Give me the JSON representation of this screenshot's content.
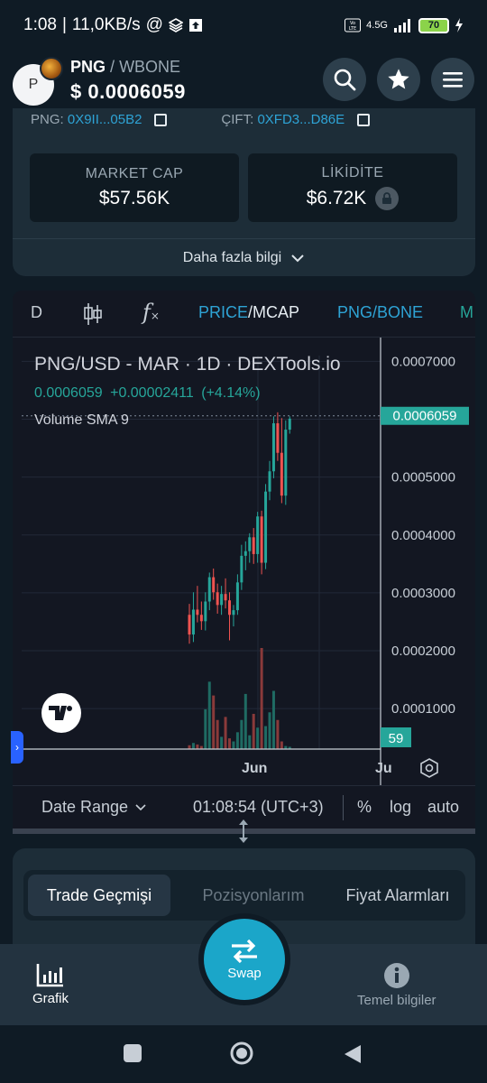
{
  "status_bar": {
    "time": "1:08",
    "speed": "11,0KB/s",
    "network": "4.5G",
    "battery": "70"
  },
  "header": {
    "avatar_letter": "P",
    "base": "PNG",
    "separator": "/",
    "quote": "WBONE",
    "price": "$ 0.0006059"
  },
  "info": {
    "token_label": "PNG:",
    "token_addr": "0X9II...05B2",
    "pair_label": "ÇIFT:",
    "pair_addr": "0XFD3...D86E",
    "market_cap_label": "MARKET CAP",
    "market_cap_value": "$57.56K",
    "liquidity_label": "LİKİDİTE",
    "liquidity_value": "$6.72K",
    "more_label": "Daha fazla bilgi"
  },
  "chart_toolbar": {
    "interval": "D",
    "fx": "f",
    "price_label": "PRICE",
    "slash": "/",
    "mcap_label": "MCAP",
    "pair_label": "PNG/BONE",
    "cut_label": "M"
  },
  "chart_data": {
    "type": "candlestick",
    "title": "PNG/USD - MAR · 1D · DEXTools.io",
    "last_price": "0.0006059",
    "change": "+0.00002411",
    "change_pct": "(+4.14%)",
    "indicator": "Volume SMA 9",
    "ylim": [
      3e-05,
      0.00071
    ],
    "y_ticks": [
      0.0007,
      0.0006,
      0.0005,
      0.0004,
      0.0003,
      0.0002,
      0.0001
    ],
    "y_tick_labels": [
      "0.0007000",
      "0.0006000",
      "0.0005000",
      "0.0004000",
      "0.0003000",
      "0.0002000",
      "0.0001000"
    ],
    "price_tag": "0.0006059",
    "volume_tag": "59",
    "x_labels": [
      "Jun",
      "Ju"
    ],
    "up_color": "#26a69a",
    "down_color": "#ef5350",
    "candles": [
      {
        "o": 0.000262,
        "h": 0.000281,
        "l": 0.000212,
        "c": 0.000228
      },
      {
        "o": 0.000228,
        "h": 0.000301,
        "l": 0.000215,
        "c": 0.000271
      },
      {
        "o": 0.000271,
        "h": 0.000312,
        "l": 0.000249,
        "c": 0.000262
      },
      {
        "o": 0.000262,
        "h": 0.000285,
        "l": 0.000236,
        "c": 0.000251
      },
      {
        "o": 0.000251,
        "h": 0.000301,
        "l": 0.000235,
        "c": 0.000285
      },
      {
        "o": 0.000285,
        "h": 0.000335,
        "l": 0.00027,
        "c": 0.000327
      },
      {
        "o": 0.000327,
        "h": 0.000342,
        "l": 0.000288,
        "c": 0.000301
      },
      {
        "o": 0.000301,
        "h": 0.000316,
        "l": 0.000264,
        "c": 0.000279
      },
      {
        "o": 0.000279,
        "h": 0.000312,
        "l": 0.000262,
        "c": 0.000298
      },
      {
        "o": 0.000298,
        "h": 0.000325,
        "l": 0.000273,
        "c": 0.000287
      },
      {
        "o": 0.000287,
        "h": 0.000301,
        "l": 0.000218,
        "c": 0.000262
      },
      {
        "o": 0.000262,
        "h": 0.000279,
        "l": 0.000242,
        "c": 0.00027
      },
      {
        "o": 0.00027,
        "h": 0.000332,
        "l": 0.000262,
        "c": 0.000318
      },
      {
        "o": 0.000318,
        "h": 0.000383,
        "l": 0.000305,
        "c": 0.000364
      },
      {
        "o": 0.000364,
        "h": 0.000389,
        "l": 0.000339,
        "c": 0.000372
      },
      {
        "o": 0.000372,
        "h": 0.000403,
        "l": 0.000352,
        "c": 0.000396
      },
      {
        "o": 0.000396,
        "h": 0.000412,
        "l": 0.00035,
        "c": 0.000367
      },
      {
        "o": 0.000367,
        "h": 0.00044,
        "l": 0.000352,
        "c": 0.000432
      },
      {
        "o": 0.000432,
        "h": 0.000442,
        "l": 0.000332,
        "c": 0.000352
      },
      {
        "o": 0.000352,
        "h": 0.000488,
        "l": 0.000341,
        "c": 0.000475
      },
      {
        "o": 0.000475,
        "h": 0.000528,
        "l": 0.00046,
        "c": 0.00051
      },
      {
        "o": 0.00051,
        "h": 0.000605,
        "l": 0.000498,
        "c": 0.000593
      },
      {
        "o": 0.000593,
        "h": 0.000612,
        "l": 0.000528,
        "c": 0.000542
      },
      {
        "o": 0.000542,
        "h": 0.000602,
        "l": 0.000455,
        "c": 0.000468
      },
      {
        "o": 0.000468,
        "h": 0.000598,
        "l": 0.000452,
        "c": 0.000582
      },
      {
        "o": 0.000582,
        "h": 0.000605,
        "l": 0.000575,
        "c": 0.000601
      }
    ],
    "volumes": [
      5,
      8,
      6,
      4,
      52,
      88,
      70,
      38,
      16,
      42,
      14,
      10,
      22,
      38,
      72,
      18,
      46,
      28,
      132,
      30,
      48,
      76,
      38,
      10,
      4,
      3
    ]
  },
  "chart_footer": {
    "date_range": "Date Range",
    "time": "01:08:54 (UTC+3)",
    "percent": "%",
    "log": "log",
    "auto": "auto"
  },
  "tabs": [
    "Trade Geçmişi",
    "Pozisyonlarım",
    "Fiyat Alarmları"
  ],
  "bottom_nav": {
    "left": "Grafik",
    "center": "Swap",
    "right": "Temel bilgiler"
  },
  "colors": {
    "accent": "#1ba6c9",
    "up": "#26a69a",
    "down": "#ef5350",
    "link": "#2ea3d5",
    "toolbar_link": "#2ea3d5"
  }
}
